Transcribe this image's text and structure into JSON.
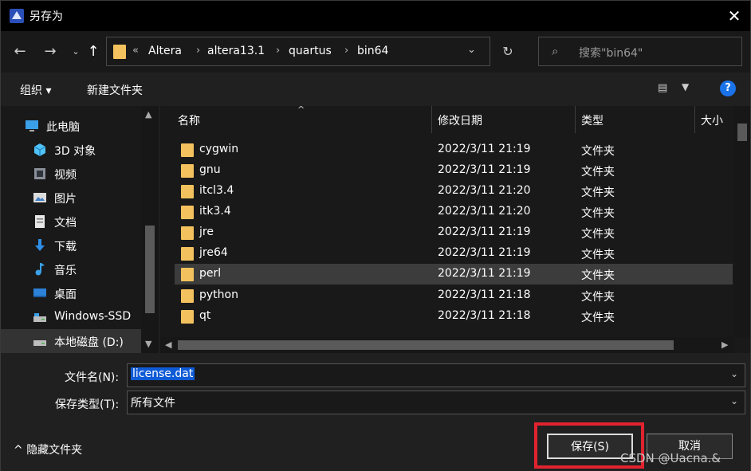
{
  "window": {
    "title": "另存为",
    "close_label": "✕"
  },
  "nav": {
    "breadcrumb": [
      "Altera",
      "altera13.1",
      "quartus",
      "bin64"
    ],
    "overflow": "«",
    "search_placeholder": "搜索\"bin64\""
  },
  "toolbar": {
    "organize": "组织 ▾",
    "new_folder": "新建文件夹"
  },
  "sidebar": {
    "items": [
      {
        "label": "此电脑",
        "icon": "computer-icon"
      },
      {
        "label": "3D 对象",
        "icon": "cube-icon"
      },
      {
        "label": "视频",
        "icon": "video-icon"
      },
      {
        "label": "图片",
        "icon": "picture-icon"
      },
      {
        "label": "文档",
        "icon": "document-icon"
      },
      {
        "label": "下载",
        "icon": "download-icon"
      },
      {
        "label": "音乐",
        "icon": "music-icon"
      },
      {
        "label": "桌面",
        "icon": "desktop-icon"
      },
      {
        "label": "Windows-SSD",
        "icon": "drive-icon"
      },
      {
        "label": "本地磁盘 (D:)",
        "icon": "drive-icon"
      }
    ]
  },
  "columns": {
    "name": "名称",
    "date": "修改日期",
    "type": "类型",
    "size": "大小"
  },
  "files": [
    {
      "name": "cygwin",
      "date": "2022/3/11 21:19",
      "type": "文件夹"
    },
    {
      "name": "gnu",
      "date": "2022/3/11 21:19",
      "type": "文件夹"
    },
    {
      "name": "itcl3.4",
      "date": "2022/3/11 21:20",
      "type": "文件夹"
    },
    {
      "name": "itk3.4",
      "date": "2022/3/11 21:20",
      "type": "文件夹"
    },
    {
      "name": "jre",
      "date": "2022/3/11 21:19",
      "type": "文件夹"
    },
    {
      "name": "jre64",
      "date": "2022/3/11 21:19",
      "type": "文件夹"
    },
    {
      "name": "perl",
      "date": "2022/3/11 21:19",
      "type": "文件夹"
    },
    {
      "name": "python",
      "date": "2022/3/11 21:18",
      "type": "文件夹"
    },
    {
      "name": "qt",
      "date": "2022/3/11 21:18",
      "type": "文件夹"
    }
  ],
  "form": {
    "filename_label": "文件名(N):",
    "filename_value": "license.dat",
    "filetype_label": "保存类型(T):",
    "filetype_value": "所有文件",
    "hide_folders": "隐藏文件夹",
    "save": "保存(S)",
    "cancel": "取消"
  },
  "watermark": "CSDN @Uacna.&"
}
